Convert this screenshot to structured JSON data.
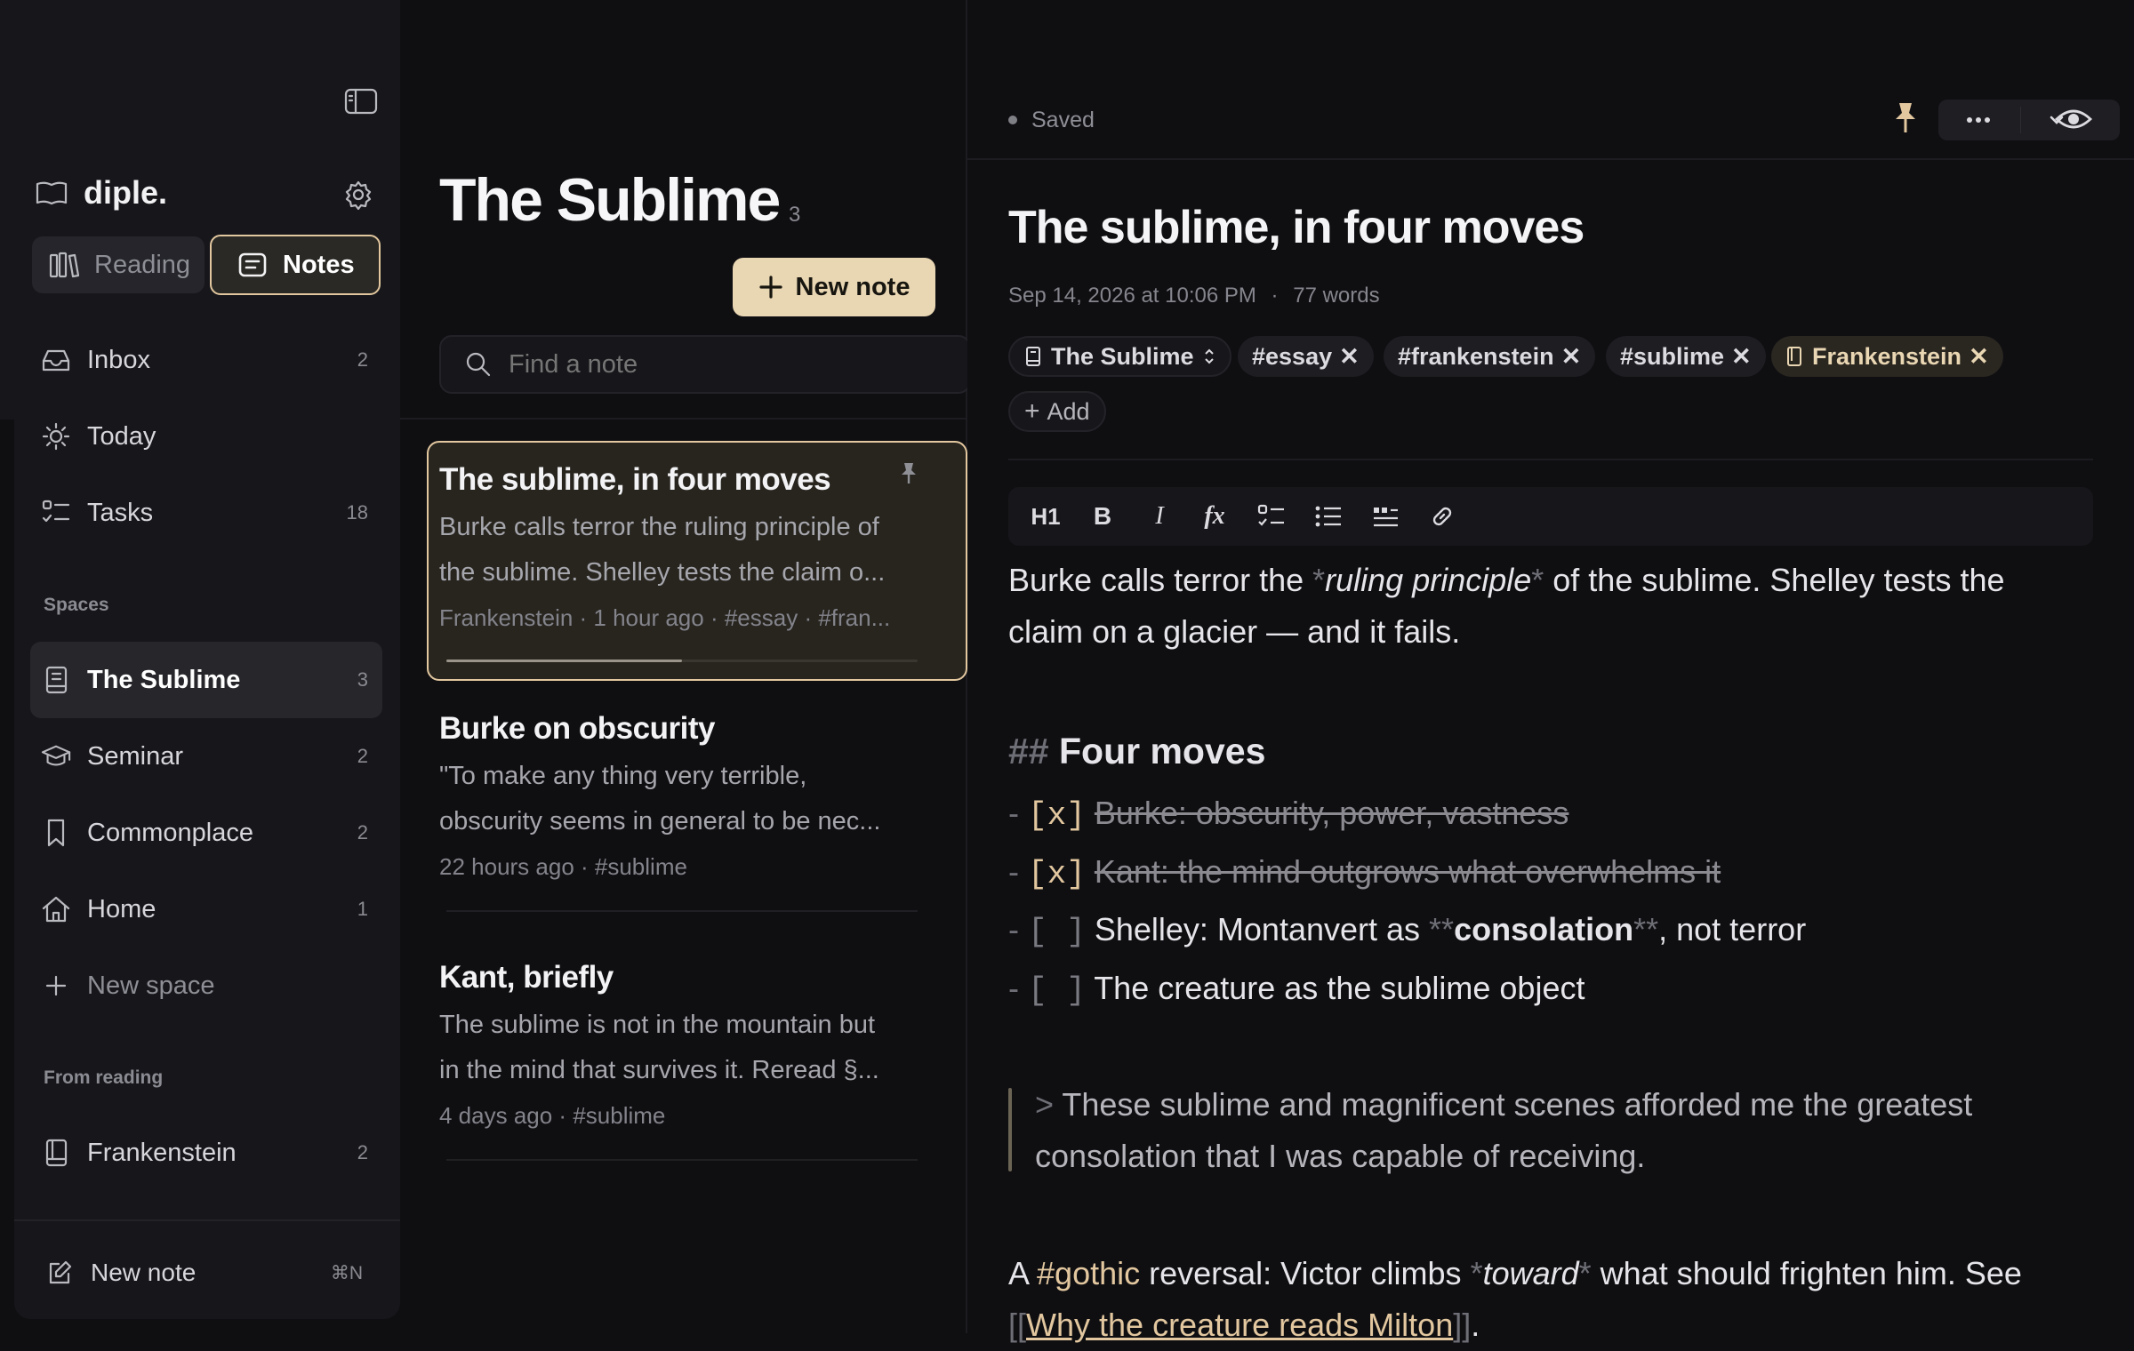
{
  "app": {
    "name": "diple."
  },
  "sidebar": {
    "modes": [
      {
        "label": "Reading"
      },
      {
        "label": "Notes"
      }
    ],
    "nav": [
      {
        "label": "Inbox",
        "count": "2"
      },
      {
        "label": "Today",
        "count": ""
      },
      {
        "label": "Tasks",
        "count": "18"
      }
    ],
    "spaces_heading": "Spaces",
    "spaces": [
      {
        "label": "The Sublime",
        "count": "3"
      },
      {
        "label": "Seminar",
        "count": "2"
      },
      {
        "label": "Commonplace",
        "count": "2"
      },
      {
        "label": "Home",
        "count": "1"
      }
    ],
    "new_space": "New space",
    "from_reading_heading": "From reading",
    "from_reading": [
      {
        "label": "Frankenstein",
        "count": "2"
      }
    ],
    "new_note": "New note",
    "new_note_shortcut": "⌘N"
  },
  "list": {
    "title": "The Sublime",
    "count": "3",
    "new_note_button": "New note",
    "search_placeholder": "Find a note",
    "notes": [
      {
        "title": "The sublime, in four moves",
        "preview": "Burke calls terror the ruling principle of the sublime. Shelley tests the claim o...",
        "preview_line1": "Burke calls terror the ruling principle of",
        "preview_line2": "the sublime. Shelley tests the claim o...",
        "meta": "Frankenstein · 1 hour ago · #essay · #fran...",
        "pinned": true,
        "selected": true,
        "progress": 0.5
      },
      {
        "title": "Burke on obscurity",
        "preview_line1": "\"To make any thing very terrible,",
        "preview_line2": "obscurity seems in general to be nec...",
        "meta": "22 hours ago · #sublime"
      },
      {
        "title": "Kant, briefly",
        "preview_line1": "The sublime is not in the mountain but",
        "preview_line2": "in the mind that survives it. Reread §...",
        "meta": "4 days ago · #sublime"
      }
    ]
  },
  "editor": {
    "status": "Saved",
    "title": "The sublime, in four moves",
    "date": "Sep 14, 2026 at 10:06 PM",
    "sep": "·",
    "words": "77 words",
    "space_chip": "The Sublime",
    "tags": [
      "#essay",
      "#frankenstein",
      "#sublime"
    ],
    "link_chip": "Frankenstein",
    "add_label": "Add",
    "toolbar": {
      "h1": "H1",
      "bold": "B",
      "italic": "I",
      "fx": "fx"
    },
    "content": {
      "p1_a": "Burke calls terror the ",
      "p1_star": "*",
      "p1_em": "ruling principle",
      "p1_b": " of the sublime. Shelley tests the",
      "p1_line2": "claim on a glacier — and it fails.",
      "h2_mark": "##",
      "h2": " Four moves",
      "dash": "-",
      "chk_done": "[x]",
      "chk_open": "[ ]",
      "task1": "Burke: obscurity, power, vastness",
      "task2": "Kant: the mind outgrows what overwhelms it",
      "task3_a": "Shelley: Montanvert as ",
      "task3_mark": "**",
      "task3_bold": "consolation",
      "task3_b": ", not terror",
      "task4": "The creature as the sublime object",
      "quote_mark": ">",
      "quote_l1": " These sublime and magnificent scenes afforded me the greatest",
      "quote_l2": "consolation that I was capable of receiving.",
      "p2_a": "A ",
      "p2_tag": "#gothic",
      "p2_b": " reversal: Victor climbs ",
      "p2_em": "toward",
      "p2_c": " what should frighten him. See",
      "link_open": "[[",
      "link_text": "Why the creature reads Milton",
      "link_close": "]]",
      "link_end": "."
    }
  },
  "colors": {
    "accent": "#e9d6b3",
    "accent_border": "#e2c79f",
    "bg": "#0f0f12",
    "panel": "#17171b"
  }
}
